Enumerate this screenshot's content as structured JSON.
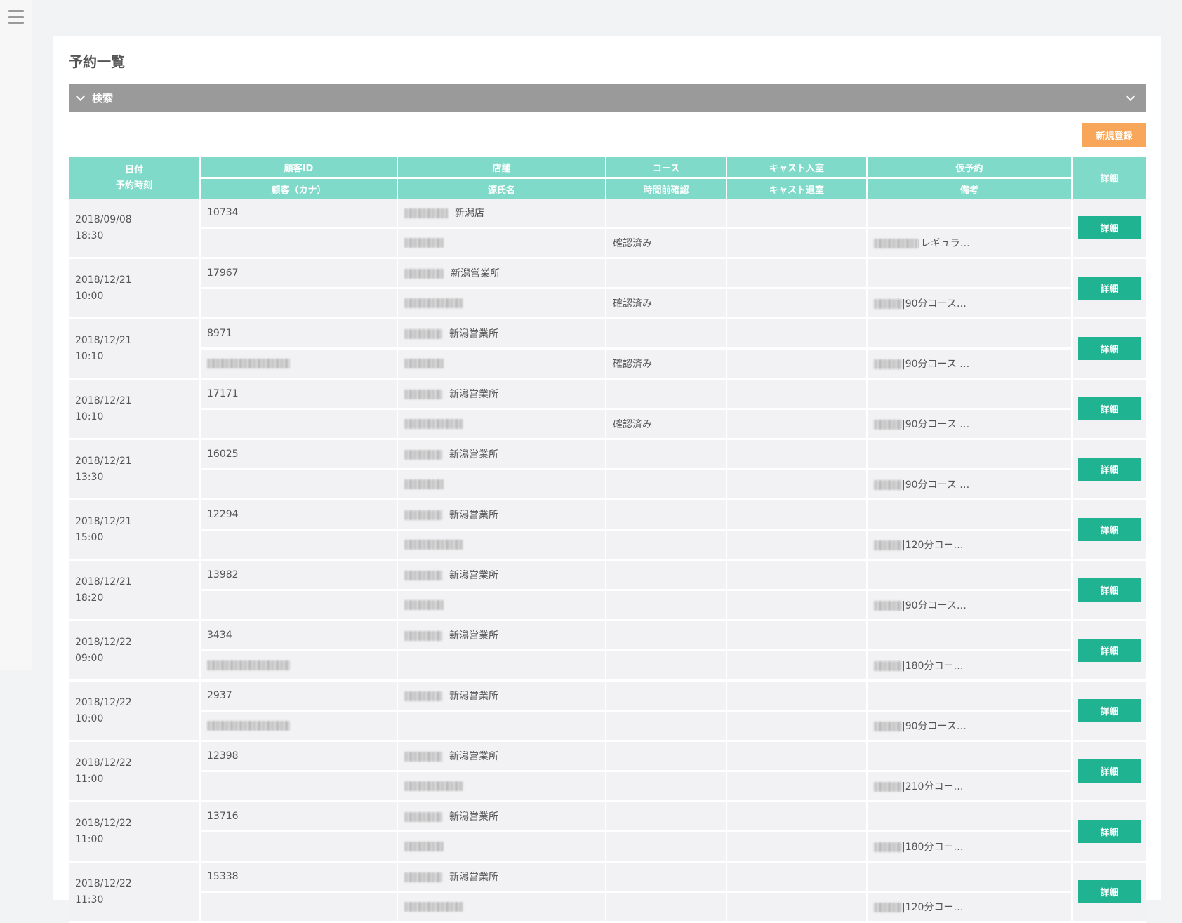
{
  "page": {
    "title": "予約一覧"
  },
  "search": {
    "label": "検索"
  },
  "new_button": "新規登録",
  "headers": {
    "date": "日付",
    "time": "予約時刻",
    "customer_id": "顧客ID",
    "customer_kana": "顧客（カナ）",
    "store": "店舗",
    "stage_name": "源氏名",
    "course": "コース",
    "pre_confirm": "時間前確認",
    "cast_in": "キャスト入室",
    "cast_out": "キャスト退室",
    "tentative": "仮予約",
    "remarks": "備考",
    "detail": "詳細"
  },
  "detail_label": "詳細",
  "rows": [
    {
      "date": "2018/09/08",
      "time": "18:30",
      "id": "10734",
      "store": "新潟店",
      "confirm": "確認済み",
      "remark": "|レギュラ…",
      "kana": false
    },
    {
      "date": "2018/12/21",
      "time": "10:00",
      "id": "17967",
      "store": "新潟営業所",
      "confirm": "確認済み",
      "remark": "|90分コース…",
      "kana": false
    },
    {
      "date": "2018/12/21",
      "time": "10:10",
      "id": "8971",
      "store": "新潟営業所",
      "confirm": "確認済み",
      "remark": "|90分コース …",
      "kana": true
    },
    {
      "date": "2018/12/21",
      "time": "10:10",
      "id": "17171",
      "store": "新潟営業所",
      "confirm": "確認済み",
      "remark": "|90分コース …",
      "kana": false
    },
    {
      "date": "2018/12/21",
      "time": "13:30",
      "id": "16025",
      "store": "新潟営業所",
      "confirm": "",
      "remark": "|90分コース …",
      "kana": false
    },
    {
      "date": "2018/12/21",
      "time": "15:00",
      "id": "12294",
      "store": "新潟営業所",
      "confirm": "",
      "remark": "|120分コー…",
      "kana": false
    },
    {
      "date": "2018/12/21",
      "time": "18:20",
      "id": "13982",
      "store": "新潟営業所",
      "confirm": "",
      "remark": "|90分コース…",
      "kana": false
    },
    {
      "date": "2018/12/22",
      "time": "09:00",
      "id": "3434",
      "store": "新潟営業所",
      "confirm": "",
      "remark": "|180分コー…",
      "kana": true,
      "no_stage": true
    },
    {
      "date": "2018/12/22",
      "time": "10:00",
      "id": "2937",
      "store": "新潟営業所",
      "confirm": "",
      "remark": "|90分コース…",
      "kana": true,
      "no_stage": true
    },
    {
      "date": "2018/12/22",
      "time": "11:00",
      "id": "12398",
      "store": "新潟営業所",
      "confirm": "",
      "remark": "|210分コー…",
      "kana": false
    },
    {
      "date": "2018/12/22",
      "time": "11:00",
      "id": "13716",
      "store": "新潟営業所",
      "confirm": "",
      "remark": "|180分コー…",
      "kana": false
    },
    {
      "date": "2018/12/22",
      "time": "11:30",
      "id": "15338",
      "store": "新潟営業所",
      "confirm": "",
      "remark": "|120分コー…",
      "kana": false
    }
  ]
}
